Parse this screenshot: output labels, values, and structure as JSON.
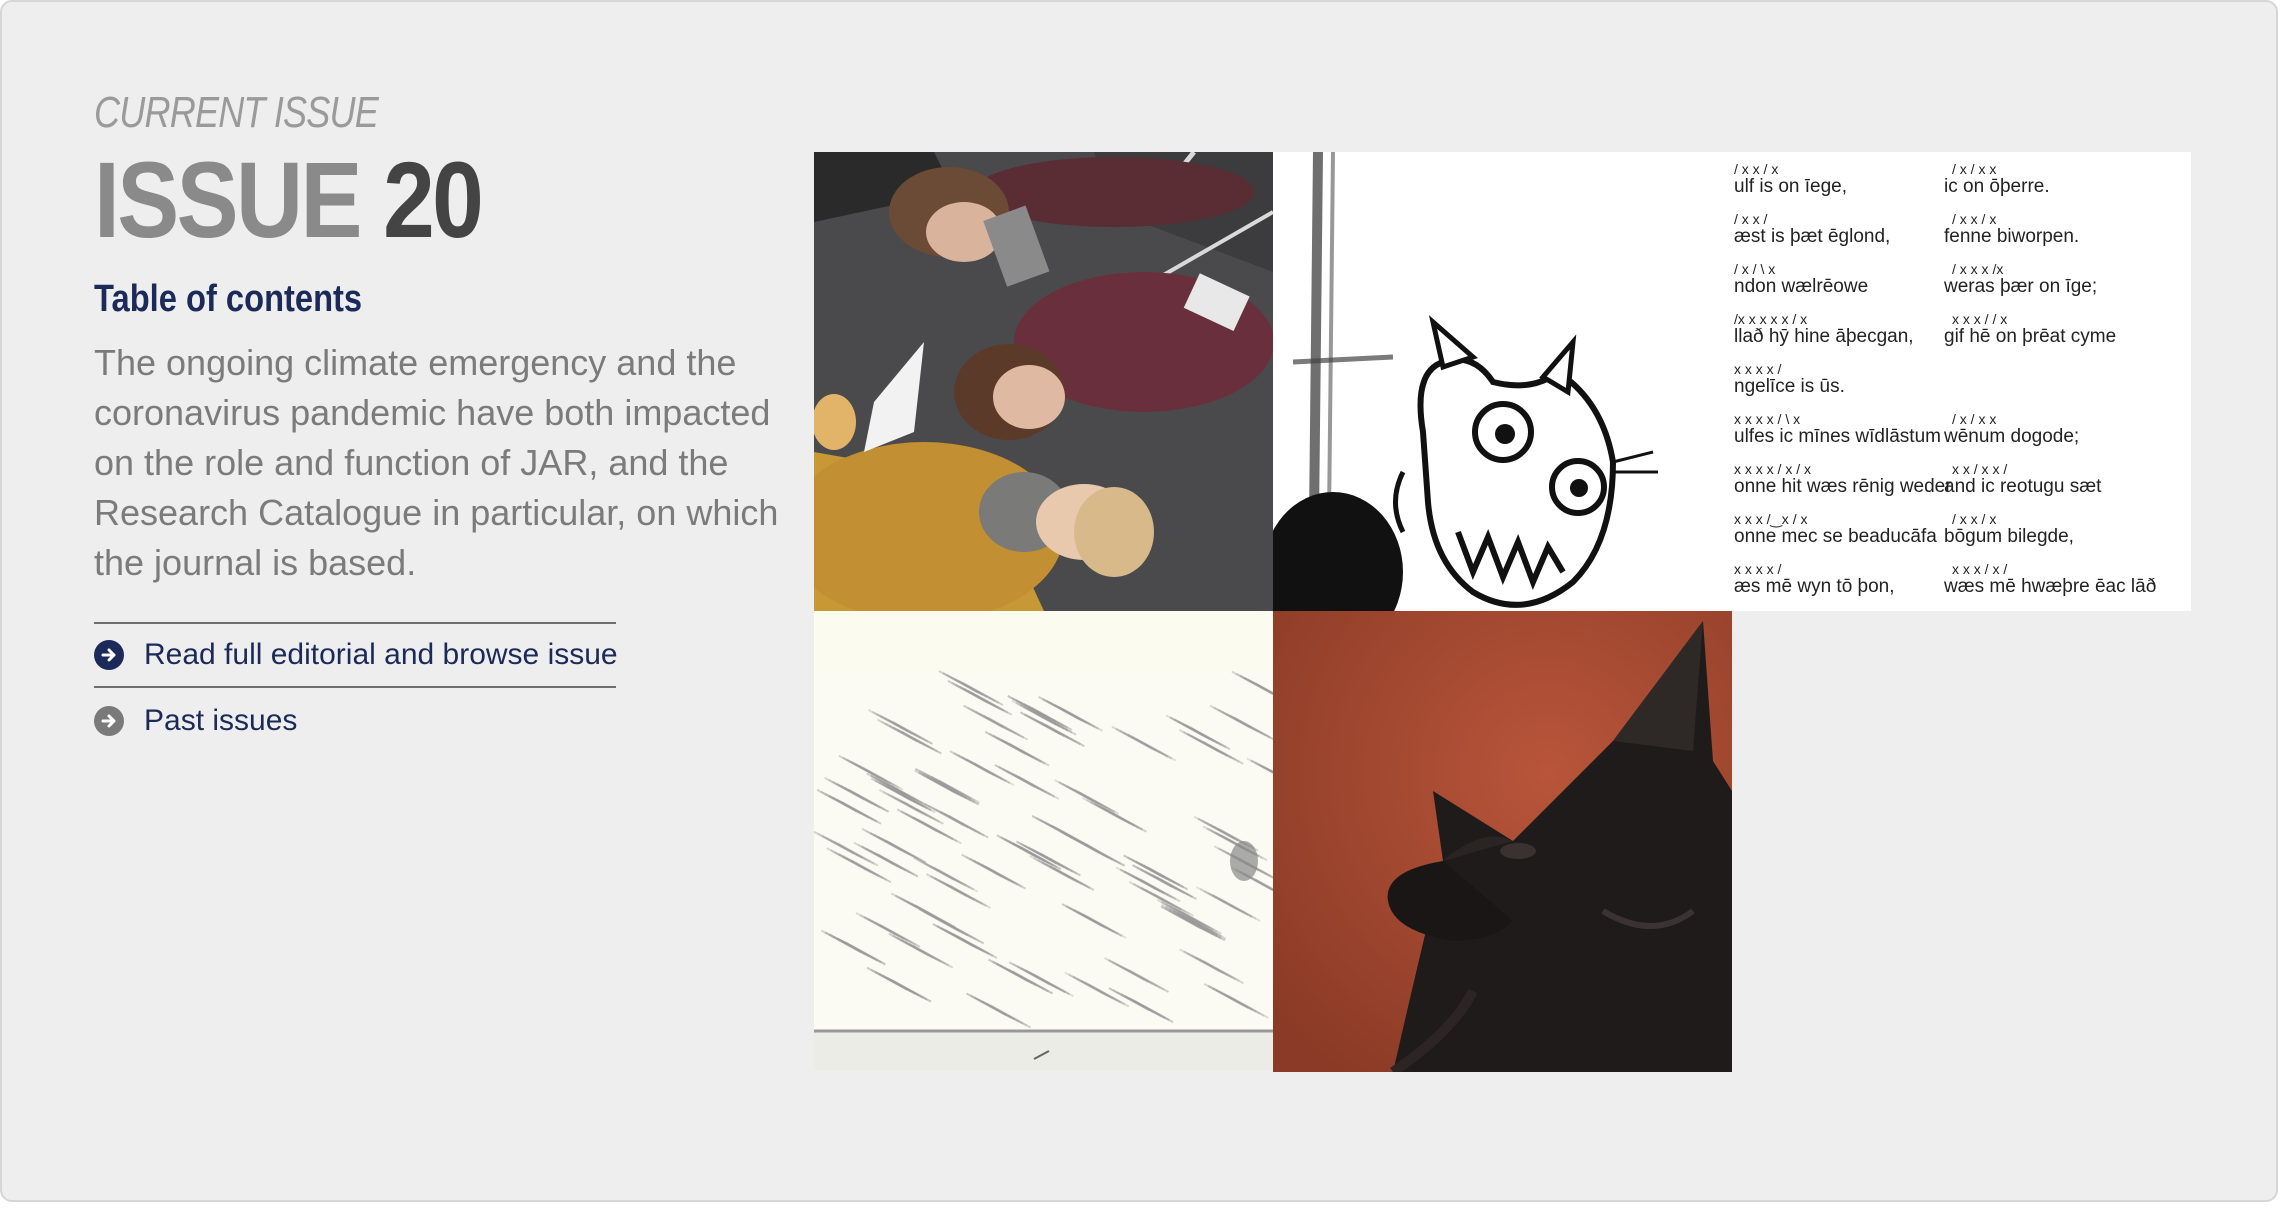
{
  "header": {
    "eyebrow": "CURRENT ISSUE",
    "issue_word": "ISSUE",
    "issue_number": "20"
  },
  "toc": {
    "heading": "Table of contents",
    "description": "The ongoing climate emergency and the coronavirus pandemic have both impacted on the role and function of JAR, and the Research Catalogue in particular, on which the journal is based."
  },
  "links": {
    "editorial": "Read full editorial and browse issue",
    "past": "Past issues"
  },
  "tiles": {
    "poem_lines": [
      {
        "left": "ulf is on īege,",
        "right": "ic on ōþerre."
      },
      {
        "left": "æst is þæt ēglond,",
        "right": "fenne biworpen."
      },
      {
        "left": "ndon wælrēowe",
        "right": "weras þær on īge;"
      },
      {
        "left": "llað hȳ hine āþecgan,",
        "right": "gif hē on þrēat cyme"
      },
      {
        "left": "ngelīce is ūs.",
        "right": ""
      },
      {
        "left": "ulfes ic mīnes wīdlāstum",
        "right": "wēnum dogode;"
      },
      {
        "left": "onne hit wæs rēnig weder",
        "right": "and ic reotugu sæt"
      },
      {
        "left": "onne mec se beaducāfa",
        "right": "bōgum bilegde,"
      },
      {
        "left": "æs mē wyn tō þon,",
        "right": "wæs mē hwæþre ēac lāð"
      }
    ],
    "scansion_left": [
      "/  x  x /  x",
      "/  x   x  /",
      "/  x  /  \\  x",
      "/x  x x x x  /  x",
      "x  x x x /",
      "x  x  x  x   /  \\  x",
      "x  x  x  x   / x  /  x",
      "x  x  x /‿x  / x",
      "x  x  x  x /"
    ],
    "scansion_right": [
      "/  x  / x  x",
      "/  x  x /  x",
      "/  x  x  x  /x",
      "x  x  x  /   /  x",
      "",
      "/  x   /  x  x",
      "x  x  /  x  x /",
      "/  x  x /  x",
      "x  x  x  /  x  /"
    ]
  },
  "colors": {
    "navy": "#1b2a58",
    "panel": "#eeeeee",
    "muted_text": "#7b7b7b"
  }
}
